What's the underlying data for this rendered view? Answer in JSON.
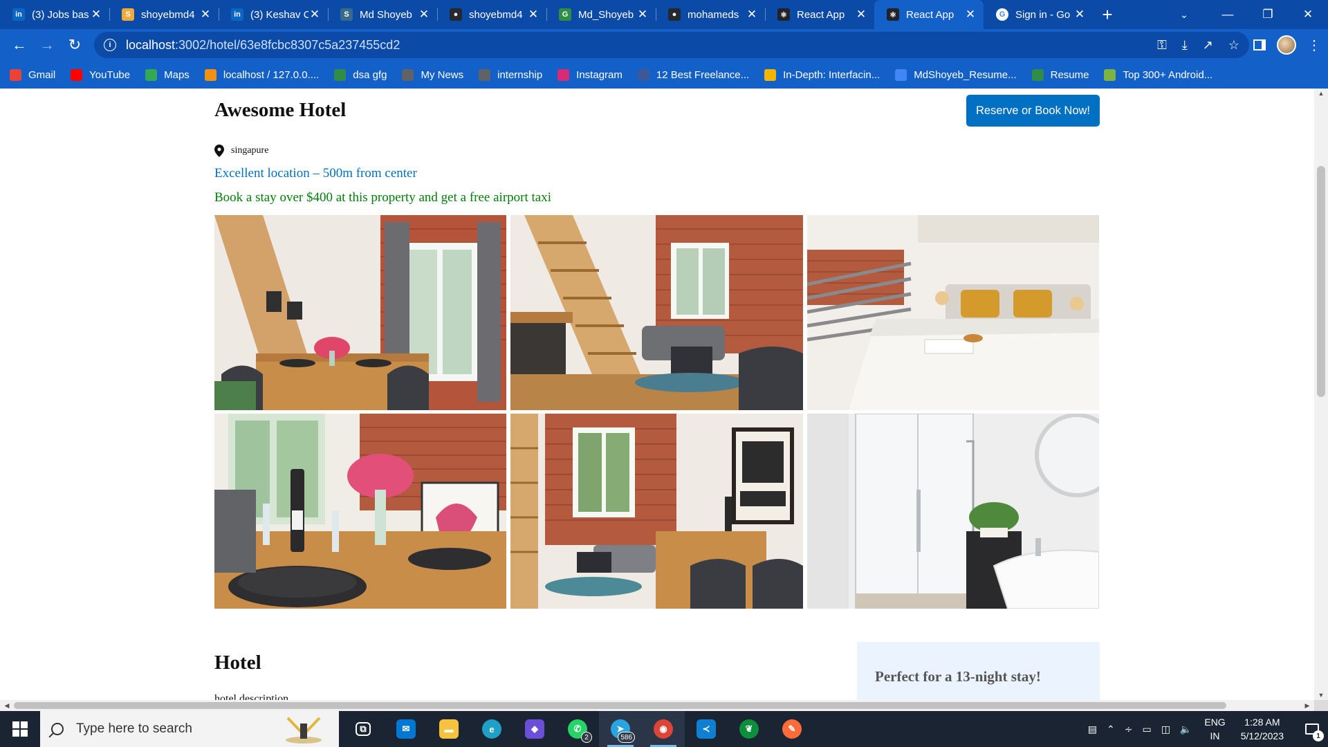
{
  "browser": {
    "tabs": [
      {
        "title": "(3) Jobs bas",
        "icon": "linkedin-icon",
        "icon_color": "#0a66c2",
        "icon_text": "in",
        "active": false
      },
      {
        "title": "shoyebmd4",
        "icon": "shield-icon",
        "icon_color": "#f2a93b",
        "icon_text": "S",
        "active": false
      },
      {
        "title": "(3) Keshav C",
        "icon": "linkedin-icon",
        "icon_color": "#0a66c2",
        "icon_text": "in",
        "active": false
      },
      {
        "title": "Md Shoyeb",
        "icon": "hackerrank-icon",
        "icon_color": "#3a6a8a",
        "icon_text": "S",
        "active": false
      },
      {
        "title": "shoyebmd4",
        "icon": "github-icon",
        "icon_color": "#24292f",
        "icon_text": "●",
        "active": false
      },
      {
        "title": "Md_Shoyeb",
        "icon": "gfg-icon",
        "icon_color": "#2f8d46",
        "icon_text": "G",
        "active": false
      },
      {
        "title": "mohameds",
        "icon": "github-icon",
        "icon_color": "#24292f",
        "icon_text": "●",
        "active": false
      },
      {
        "title": "React App",
        "icon": "react-icon",
        "icon_color": "#20232a",
        "icon_text": "⚛",
        "active": false
      },
      {
        "title": "React App",
        "icon": "react-icon",
        "icon_color": "#20232a",
        "icon_text": "⚛",
        "active": true
      },
      {
        "title": "Sign in - Go",
        "icon": "google-icon",
        "icon_color": "#ffffff",
        "icon_text": "G",
        "active": false
      }
    ],
    "url_host": "localhost",
    "url_path": ":3002/hotel/63e8fcbc8307c5a237455cd2",
    "bookmarks": [
      {
        "label": "Gmail",
        "icon": "gmail-icon",
        "color": "#ea4335"
      },
      {
        "label": "YouTube",
        "icon": "youtube-icon",
        "color": "#ff0000"
      },
      {
        "label": "Maps",
        "icon": "maps-pin-icon",
        "color": "#34a853"
      },
      {
        "label": "localhost / 127.0.0....",
        "icon": "phpmyadmin-icon",
        "color": "#f29111"
      },
      {
        "label": "dsa gfg",
        "icon": "gfg-icon",
        "color": "#2f8d46"
      },
      {
        "label": "My News",
        "icon": "globe-icon",
        "color": "#5f6368"
      },
      {
        "label": "internship",
        "icon": "globe-icon",
        "color": "#5f6368"
      },
      {
        "label": "Instagram",
        "icon": "instagram-icon",
        "color": "#d62976"
      },
      {
        "label": "12 Best Freelance...",
        "icon": "freelance-icon",
        "color": "#3b5998"
      },
      {
        "label": "In-Depth: Interfacin...",
        "icon": "pencil-icon",
        "color": "#f5b400"
      },
      {
        "label": "MdShoyeb_Resume...",
        "icon": "docs-icon",
        "color": "#4285f4"
      },
      {
        "label": "Resume",
        "icon": "gfg-icon",
        "color": "#2f8d46"
      },
      {
        "label": "Top 300+ Android...",
        "icon": "feather-icon",
        "color": "#7cb342"
      }
    ]
  },
  "hotel": {
    "name": "Awesome Hotel",
    "book_label": "Reserve or Book Now!",
    "address": "singapure",
    "distance": "Excellent location – 500m from center",
    "price_highlight": "Book a stay over $400 at this property and get a free airport taxi",
    "photos": [
      {
        "alt": "dining room with tall window",
        "scene": "dining"
      },
      {
        "alt": "living room with wooden staircase",
        "scene": "living"
      },
      {
        "alt": "bedroom with white bed and yellow pillows",
        "scene": "bedroom"
      },
      {
        "alt": "table set with wine and flowers",
        "scene": "table"
      },
      {
        "alt": "living area with Polska poster",
        "scene": "polska"
      },
      {
        "alt": "white bathroom with shower",
        "scene": "bathroom"
      }
    ],
    "details_title": "Hotel",
    "details_desc": "hotel description",
    "price_card_title": "Perfect for a 13-night stay!"
  },
  "taskbar": {
    "search_placeholder": "Type here to search",
    "apps": [
      {
        "name": "task-view-icon",
        "color": "#1b2433",
        "glyph": "⧉",
        "active": false,
        "badge": ""
      },
      {
        "name": "mail-icon",
        "color": "#0078d4",
        "glyph": "✉",
        "active": false,
        "badge": ""
      },
      {
        "name": "file-explorer-icon",
        "color": "#f7c23e",
        "glyph": "▬",
        "active": false,
        "badge": ""
      },
      {
        "name": "edge-icon",
        "color": "#1fa0c7",
        "glyph": "e",
        "active": false,
        "badge": ""
      },
      {
        "name": "copilot-icon",
        "color": "#6b4fd8",
        "glyph": "◆",
        "active": false,
        "badge": ""
      },
      {
        "name": "whatsapp-icon",
        "color": "#25d366",
        "glyph": "✆",
        "active": false,
        "badge": "2"
      },
      {
        "name": "telegram-icon",
        "color": "#2aa3df",
        "glyph": "➤",
        "active": true,
        "badge": "586"
      },
      {
        "name": "chrome-icon",
        "color": "#db4437",
        "glyph": "◉",
        "active": true,
        "badge": ""
      },
      {
        "name": "vscode-icon",
        "color": "#0f7fd1",
        "glyph": "≺",
        "active": false,
        "badge": ""
      },
      {
        "name": "mongodb-compass-icon",
        "color": "#0b8f3a",
        "glyph": "❦",
        "active": false,
        "badge": ""
      },
      {
        "name": "postman-icon",
        "color": "#ff6c37",
        "glyph": "✎",
        "active": false,
        "badge": ""
      }
    ],
    "lang_top": "ENG",
    "lang_bottom": "IN",
    "time": "1:28 AM",
    "date": "5/12/2023",
    "notifications": "1"
  }
}
